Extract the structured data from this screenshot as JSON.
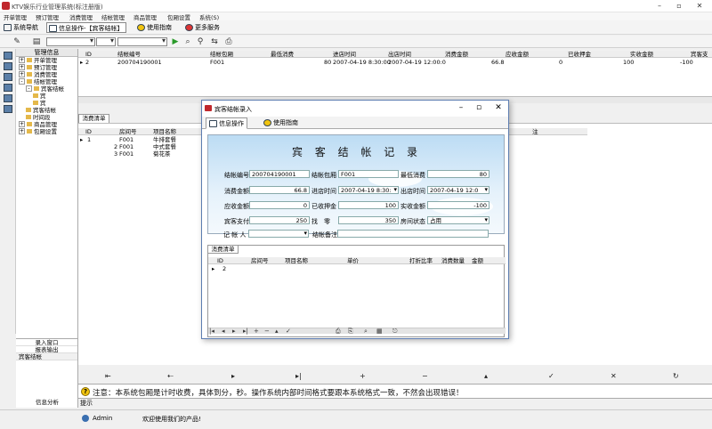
{
  "window": {
    "title": "KTV娱乐行业管理系统(标注册版)"
  },
  "menu": [
    "开单管理",
    "预订管理",
    "消费管理",
    "结帐管理",
    "商品管理",
    "包厢设置",
    "系统(S)"
  ],
  "toolbar": {
    "nav_label": "系统导航",
    "info_label": "信息操作-【宾客结帐】",
    "guide_label": "使用指南",
    "more_label": "更多服务"
  },
  "nav_panel": {
    "header": "管理信息",
    "tree": [
      {
        "label": "开单管理",
        "sign": "+",
        "level": 0
      },
      {
        "label": "预订管理",
        "sign": "+",
        "level": 0
      },
      {
        "label": "消费管理",
        "sign": "+",
        "level": 0
      },
      {
        "label": "结帐管理",
        "sign": "-",
        "level": 0
      },
      {
        "label": "宾客结帐",
        "sign": "-",
        "level": 1
      },
      {
        "label": "宾",
        "sign": "",
        "level": 2
      },
      {
        "label": "宾",
        "sign": "",
        "level": 2
      },
      {
        "label": "宾客结帐",
        "sign": "",
        "level": 1
      },
      {
        "label": "时间段",
        "sign": "",
        "level": 1
      },
      {
        "label": "商品管理",
        "sign": "+",
        "level": 0
      },
      {
        "label": "包厢设置",
        "sign": "+",
        "level": 0
      }
    ],
    "bottom_items": [
      "录入窗口",
      "报表输出",
      "宾客结帐"
    ],
    "bottom_footer": "信息分析"
  },
  "main_grid": {
    "headers": [
      "ID",
      "结帐编号",
      "结帐包厢",
      "最低消费",
      "进店时间",
      "出店时间",
      "消费金额",
      "应收金额",
      "已收押金",
      "实收金额",
      "宾客支"
    ],
    "row": [
      "2",
      "200704190001",
      "F001",
      "80",
      "2007-04-19 8:30:00",
      "2007-04-19 12:00:0",
      "66.8",
      "0",
      "100",
      "-100"
    ]
  },
  "detail_tab": "消费清单",
  "detail_grid": {
    "headers": [
      "ID",
      "房间号",
      "项目名称"
    ],
    "rows": [
      [
        "1",
        "F001",
        "牛排套餐"
      ],
      [
        "2",
        "F001",
        "中式套餐"
      ],
      [
        "3",
        "F001",
        "菊花茶"
      ]
    ],
    "right_header": "注"
  },
  "notice": "注意：本系统包厢是计时收费，具体到分，秒。操作系统内部时间格式要跟本系统格式一致，不然会出现错误！",
  "hint_label": "提示",
  "status": {
    "user": "Admin",
    "welcome": "欢迎使用我们的产品!"
  },
  "dialog": {
    "title": "宾客结帐录入",
    "tabs": [
      "信息操作",
      "使用指南"
    ],
    "heading": "宾 客 结 帐 记 录",
    "fields": {
      "bill_no": {
        "label": "结帐编号",
        "value": "200704190001"
      },
      "room": {
        "label": "结帐包厢",
        "value": "F001"
      },
      "min_spend": {
        "label": "最低消费",
        "value": "80"
      },
      "consume": {
        "label": "消费金额",
        "value": "66.8"
      },
      "in_time": {
        "label": "进店时间",
        "value": "2007-04-19 8:30:"
      },
      "out_time": {
        "label": "出店时间",
        "value": "2007-04-19 12:0"
      },
      "receivable": {
        "label": "应收金额",
        "value": "0"
      },
      "deposit": {
        "label": "已收押金",
        "value": "100"
      },
      "actual": {
        "label": "实收金额",
        "value": "-100"
      },
      "paid": {
        "label": "宾客支付",
        "value": "250"
      },
      "change": {
        "label": "找　零",
        "value": "350"
      },
      "room_state": {
        "label": "房间状态",
        "value": "占用"
      },
      "operator": {
        "label": "记 帐 人",
        "value": ""
      },
      "remark": {
        "label": "结帐备注",
        "value": ""
      }
    },
    "sub_tab": "消费清单",
    "sub_headers": [
      "ID",
      "房间号",
      "项目名称",
      "单价",
      "打折比率",
      "消费数量",
      "金额"
    ],
    "sub_row": [
      "2"
    ]
  }
}
